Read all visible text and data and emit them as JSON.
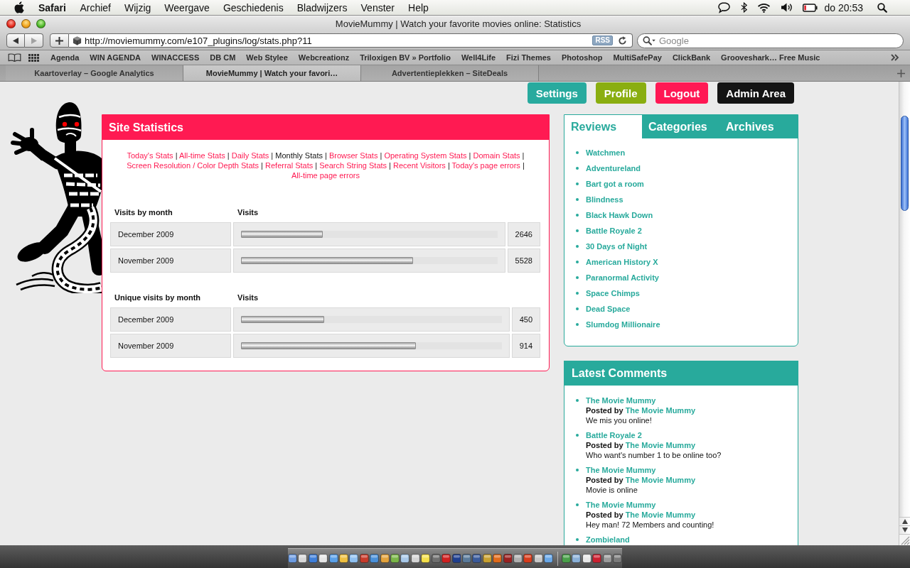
{
  "menu_bar": {
    "app": "Safari",
    "menus": [
      "Archief",
      "Wijzig",
      "Weergave",
      "Geschiedenis",
      "Bladwijzers",
      "Venster",
      "Help"
    ],
    "clock": "do 20:53"
  },
  "window": {
    "title": "MovieMummy | Watch your favorite movies online: Statistics"
  },
  "toolbar": {
    "back_disabled": false,
    "forward_disabled": true,
    "address": "http://moviemummy.com/e107_plugins/log/stats.php?11",
    "rss": "RSS",
    "search": {
      "placeholder": "Google"
    }
  },
  "bookmarks": [
    "Agenda",
    "WIN AGENDA",
    "WINACCESS",
    "DB CM",
    "Web Stylee",
    "Webcreationz",
    "Triloxigen BV » Portfolio",
    "Well4Life",
    "Fizi Themes",
    "Photoshop",
    "MultiSafePay",
    "ClickBank",
    "Grooveshark… Free Music"
  ],
  "tabs": [
    {
      "label": "Kaartoverlay – Google Analytics",
      "selected": false
    },
    {
      "label": "MovieMummy | Watch your favori…",
      "selected": true
    },
    {
      "label": "Advertentieplekken – SiteDeals",
      "selected": false
    }
  ],
  "page": {
    "nav_buttons": [
      {
        "label": "Settings",
        "color": "#28aa9e"
      },
      {
        "label": "Profile",
        "color": "#8aae10"
      },
      {
        "label": "Logout",
        "color": "#ff1854"
      },
      {
        "label": "Admin Area",
        "color": "#141414"
      }
    ],
    "stats_panel": {
      "title": "Site Statistics",
      "separator": "|",
      "links": [
        {
          "label": "Today's Stats",
          "selected": false
        },
        {
          "label": "All-time Stats",
          "selected": false
        },
        {
          "label": "Daily Stats",
          "selected": false
        },
        {
          "label": "Monthly Stats",
          "selected": true
        },
        {
          "label": "Browser Stats",
          "selected": false
        },
        {
          "label": "Operating System Stats",
          "selected": false
        },
        {
          "label": "Domain Stats",
          "selected": false
        },
        {
          "label": "Screen Resolution / Color Depth Stats",
          "selected": false
        },
        {
          "label": "Referral Stats",
          "selected": false
        },
        {
          "label": "Search String Stats",
          "selected": false
        },
        {
          "label": "Recent Visitors",
          "selected": false
        },
        {
          "label": "Today's page errors",
          "selected": false
        },
        {
          "label": "All-time page errors",
          "selected": false
        }
      ],
      "tables": [
        {
          "columns": [
            "Visits by month",
            "Visits"
          ],
          "rows": [
            {
              "label": "December 2009",
              "level": 0.32,
              "count": "2646"
            },
            {
              "label": "November 2009",
              "level": 0.67,
              "count": "5528"
            }
          ]
        },
        {
          "columns": [
            "Unique visits by month",
            "Visits"
          ],
          "rows": [
            {
              "label": "December 2009",
              "level": 0.32,
              "count": "450"
            },
            {
              "label": "November 2009",
              "level": 0.67,
              "count": "914"
            }
          ]
        }
      ]
    },
    "reviews_box": {
      "tabs": [
        {
          "label": "Reviews",
          "selected": true
        },
        {
          "label": "Categories",
          "selected": false
        },
        {
          "label": "Archives",
          "selected": false
        }
      ],
      "items": [
        "Watchmen",
        "Adventureland",
        "Bart got a room",
        "Blindness",
        "Black Hawk Down",
        "Battle Royale 2",
        "30 Days of Night",
        "American History X",
        "Paranormal Activity",
        "Space Chimps",
        "Dead Space",
        "Slumdog Millionaire"
      ]
    },
    "comments_box": {
      "title": "Latest Comments",
      "items": [
        {
          "title": "The Movie Mummy",
          "posted_by": "Posted by",
          "author": "The Movie Mummy",
          "text": "We mis you online!"
        },
        {
          "title": "Battle Royale 2",
          "posted_by": "Posted by",
          "author": "The Movie Mummy",
          "text": "Who want's number 1 to be online too?"
        },
        {
          "title": "The Movie Mummy",
          "posted_by": "Posted by",
          "author": "The Movie Mummy",
          "text": "Movie is online"
        },
        {
          "title": "The Movie Mummy",
          "posted_by": "Posted by",
          "author": "The Movie Mummy",
          "text": "Hey man! 72 Members and counting!"
        },
        {
          "title": "Zombieland"
        }
      ]
    }
  }
}
